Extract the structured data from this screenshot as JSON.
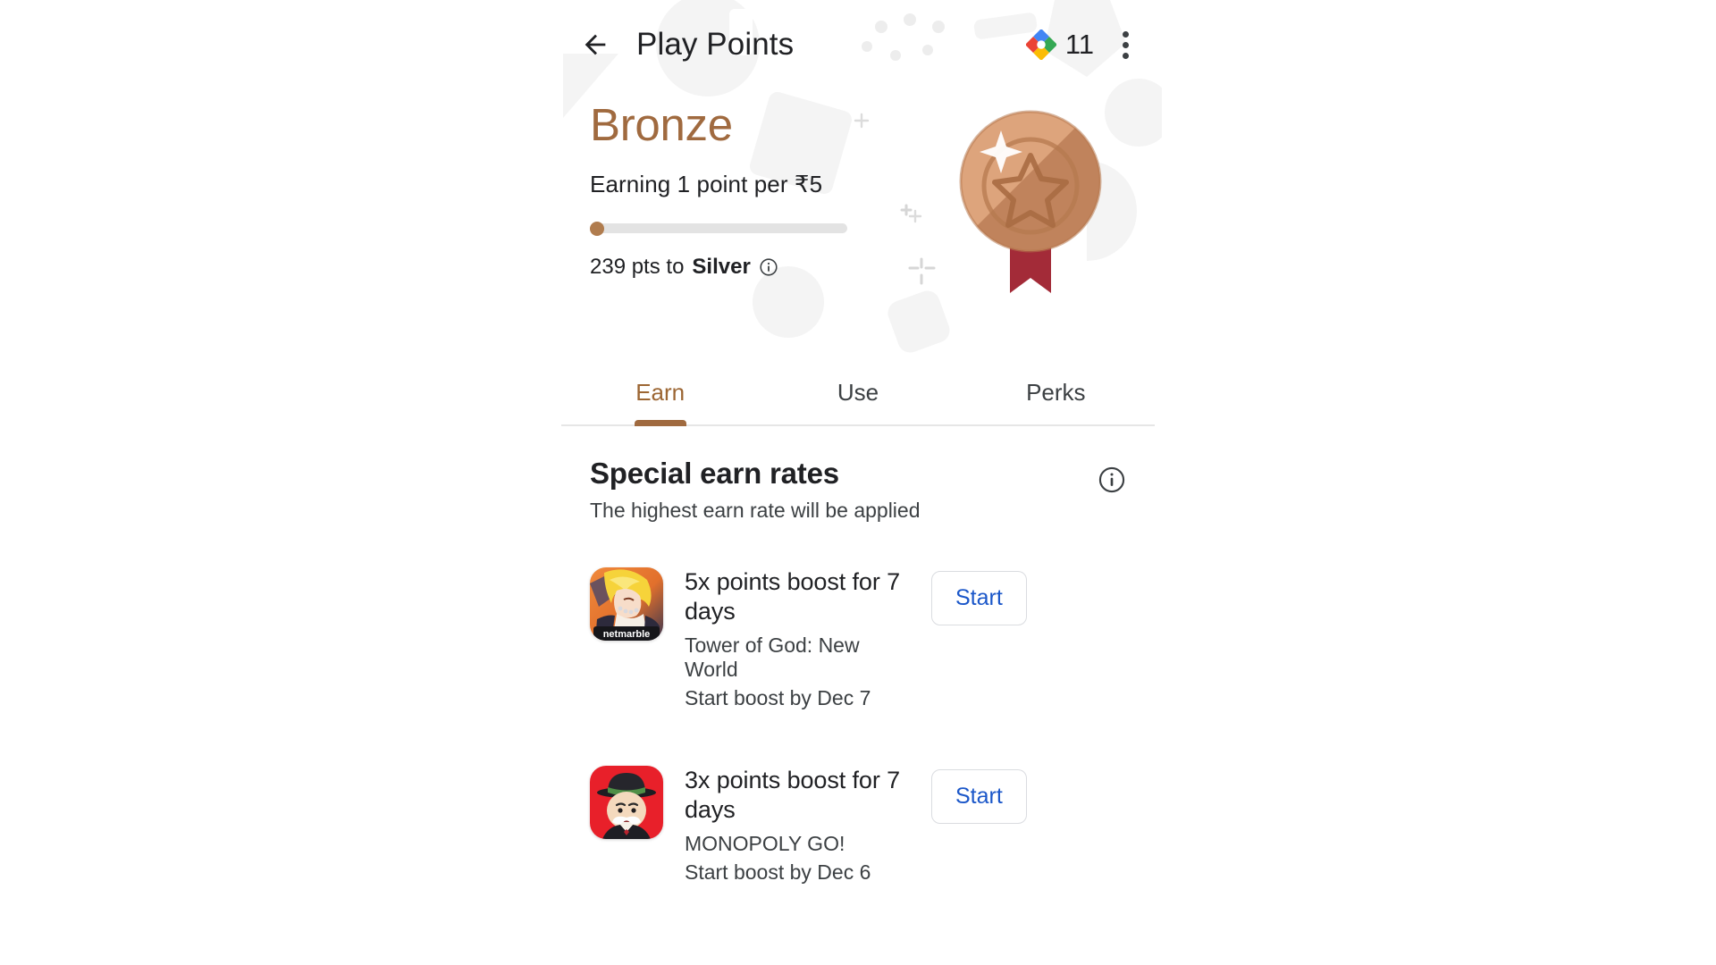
{
  "appbar": {
    "back_icon": "arrow-left-icon",
    "title": "Play Points",
    "points_logo_icon": "play-points-diamond-icon",
    "points_count": "11",
    "overflow_icon": "more-vert-icon"
  },
  "hero": {
    "tier_name": "Bronze",
    "tier_color": "#a06a3f",
    "earn_rate": "Earning 1 point per ₹5",
    "progress_percent": 0,
    "to_next_points": "239 pts to",
    "next_tier": "Silver",
    "info_icon": "info-circle-icon",
    "medal_icon": "bronze-medal-icon"
  },
  "tabs": [
    {
      "label": "Earn",
      "active": true
    },
    {
      "label": "Use",
      "active": false
    },
    {
      "label": "Perks",
      "active": false
    }
  ],
  "section": {
    "title": "Special earn rates",
    "subtitle": "The highest earn rate will be applied",
    "info_icon": "info-circle-icon"
  },
  "offers": [
    {
      "icon_name": "tower-of-god-app-icon",
      "icon_badge": "netmarble",
      "title": "5x points boost for 7 days",
      "app": "Tower of God: New World",
      "expiry": "Start boost by Dec 7",
      "action_label": "Start"
    },
    {
      "icon_name": "monopoly-go-app-icon",
      "icon_badge": "",
      "title": "3x points boost for 7 days",
      "app": "MONOPOLY GO!",
      "expiry": "Start boost by Dec 6",
      "action_label": "Start"
    }
  ],
  "colors": {
    "accent_bronze": "#a06a3f",
    "link_blue": "#1b57c9",
    "text_primary": "#202124",
    "text_secondary": "#3c4043",
    "divider": "#e6e6e6"
  }
}
